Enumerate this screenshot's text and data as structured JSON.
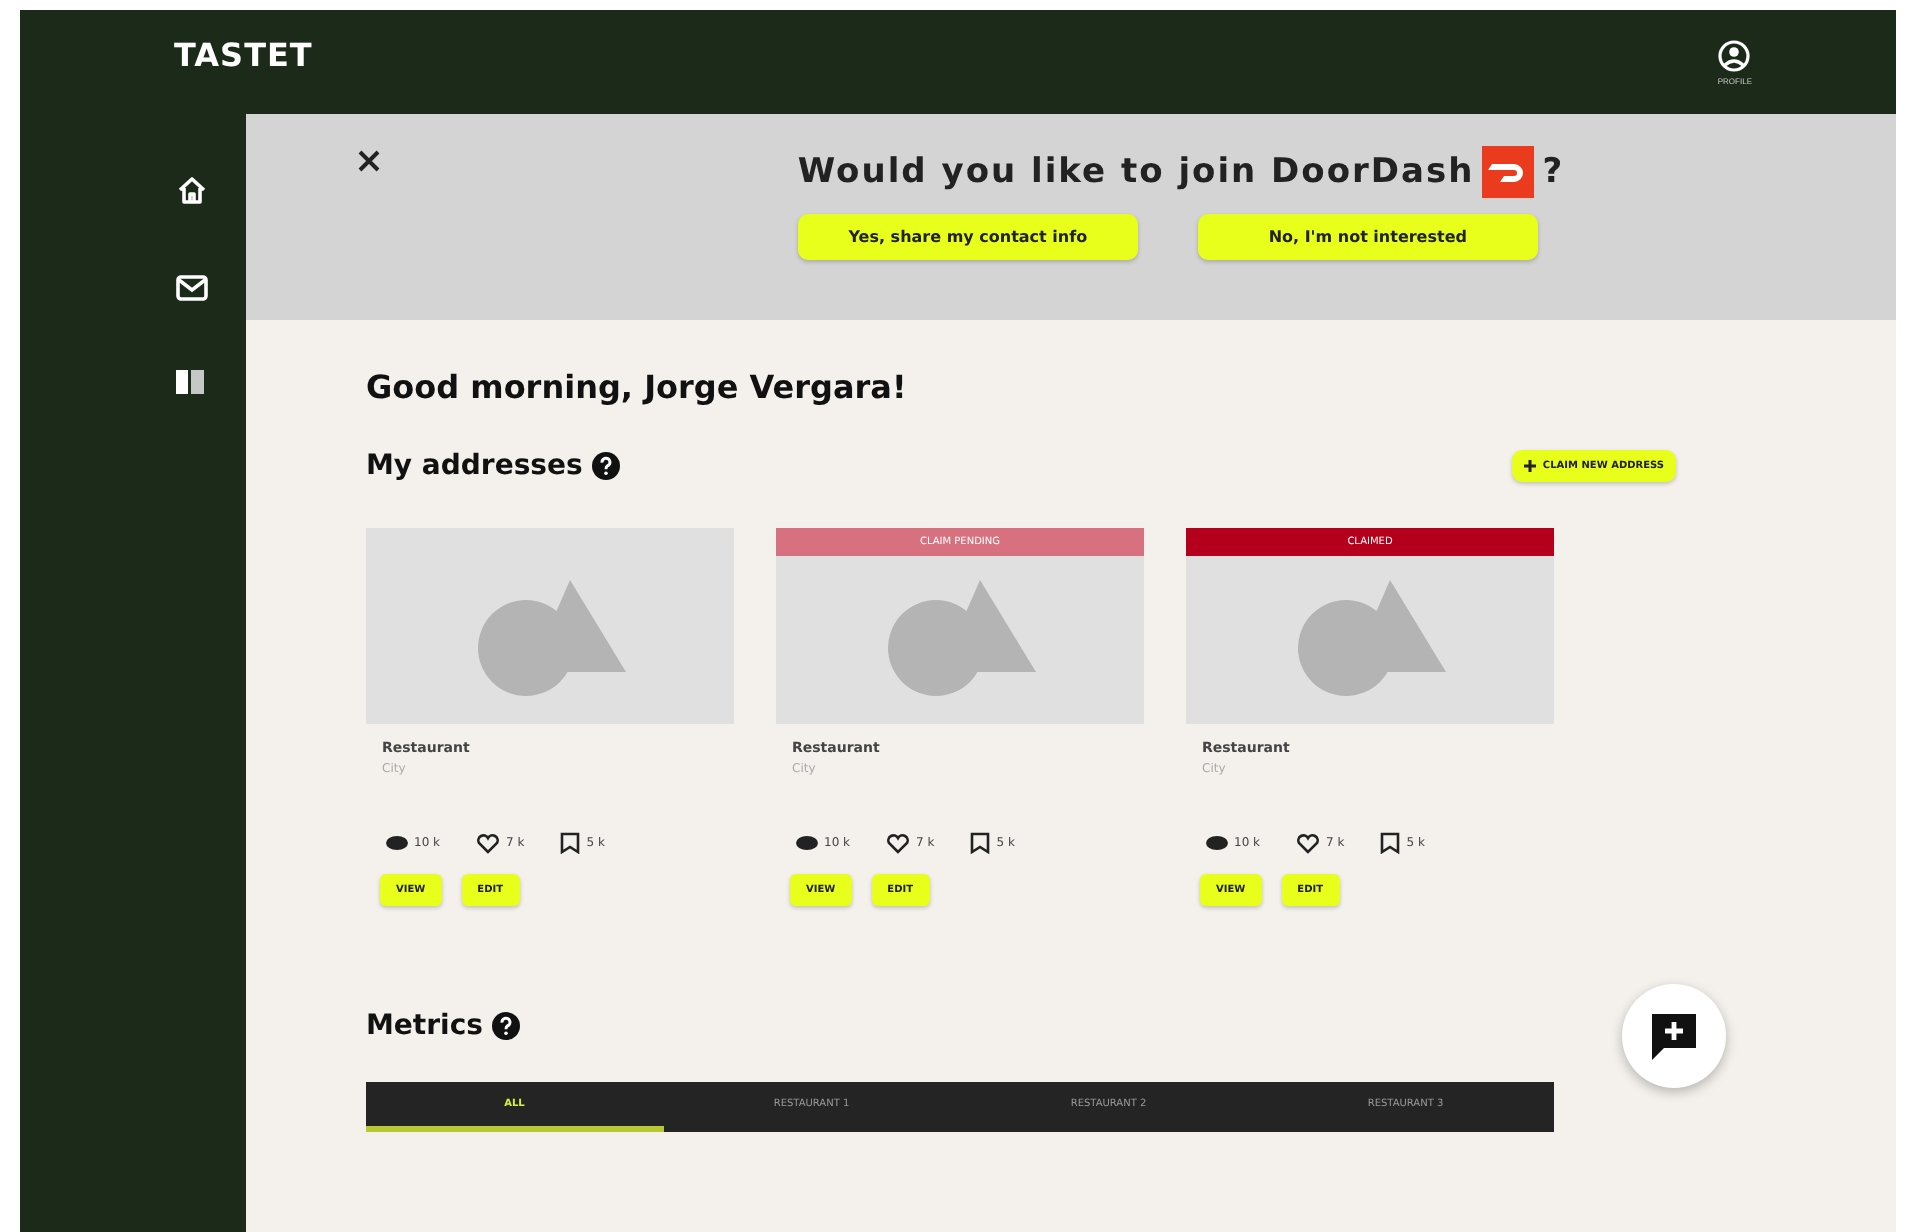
{
  "app": {
    "logo": "TASTET",
    "profile_label": "PROFILE"
  },
  "sidebar": {
    "items": [
      {
        "kind": "home",
        "selected": false
      },
      {
        "kind": "mail",
        "selected": false
      },
      {
        "kind": "book",
        "selected": false
      }
    ]
  },
  "banner": {
    "question": "Would you like to join DoorDash",
    "question_mark": "?",
    "buttons": [
      "Yes, share my contact info",
      "No, I'm not interested"
    ]
  },
  "greeting": "Good morning, Jorge Vergara!",
  "addresses": {
    "title": "My addresses",
    "claim_button": "CLAIM NEW ADDRESS",
    "cards": [
      {
        "kind": "plain",
        "name": "Restaurant",
        "city": "City",
        "views": "10 k",
        "likes": "7 k",
        "saves": "5 k",
        "buttons": [
          "VIEW",
          "EDIT"
        ]
      },
      {
        "kind": "pending",
        "status_label": "CLAIM PENDING",
        "name": "Restaurant",
        "city": "City",
        "views": "10 k",
        "likes": "7 k",
        "saves": "5 k",
        "buttons": [
          "VIEW",
          "EDIT"
        ]
      },
      {
        "kind": "claimed",
        "status_label": "CLAIMED",
        "name": "Restaurant",
        "city": "City",
        "views": "10 k",
        "likes": "7 k",
        "saves": "5 k",
        "buttons": [
          "VIEW",
          "EDIT"
        ]
      }
    ]
  },
  "metrics": {
    "title": "Metrics",
    "tabs": [
      {
        "label": "ALL",
        "selected": true
      },
      {
        "label": "RESTAURANT 1",
        "selected": false
      },
      {
        "label": "RESTAURANT 2",
        "selected": false
      },
      {
        "label": "RESTAURANT 3",
        "selected": false
      }
    ]
  }
}
